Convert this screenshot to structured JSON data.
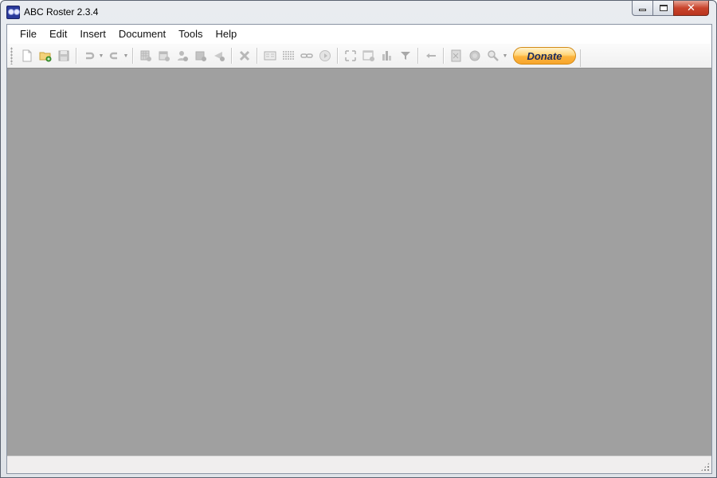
{
  "window": {
    "title": "ABC Roster 2.3.4",
    "icon": "app-logo-icon",
    "controls": [
      {
        "name": "minimize-button",
        "icon": "minimize-icon"
      },
      {
        "name": "maximize-button",
        "icon": "maximize-icon"
      },
      {
        "name": "close-button",
        "icon": "close-icon",
        "glyph": "✕"
      }
    ]
  },
  "menubar": {
    "items": [
      "File",
      "Edit",
      "Insert",
      "Document",
      "Tools",
      "Help"
    ]
  },
  "toolbar": {
    "buttons": [
      {
        "name": "new-button",
        "icon": "new-document-icon",
        "enabled": true
      },
      {
        "name": "open-button",
        "icon": "open-folder-icon",
        "enabled": true
      },
      {
        "name": "save-button",
        "icon": "save-disk-icon",
        "enabled": false
      },
      {
        "name": "undo-button",
        "icon": "undo-icon",
        "enabled": false,
        "dropdown": true
      },
      {
        "name": "redo-button",
        "icon": "redo-icon",
        "enabled": false,
        "dropdown": true
      },
      {
        "name": "add-roster-button",
        "icon": "add-grid-icon",
        "enabled": false
      },
      {
        "name": "add-calendar-button",
        "icon": "add-calendar-icon",
        "enabled": false
      },
      {
        "name": "add-person-button",
        "icon": "add-person-icon",
        "enabled": false
      },
      {
        "name": "add-shift-button",
        "icon": "add-box-icon",
        "enabled": false
      },
      {
        "name": "add-announcement-button",
        "icon": "add-megaphone-icon",
        "enabled": false
      },
      {
        "name": "delete-button",
        "icon": "delete-x-icon",
        "enabled": false
      },
      {
        "name": "properties-button",
        "icon": "properties-card-icon",
        "enabled": false
      },
      {
        "name": "columns-button",
        "icon": "columns-grid-icon",
        "enabled": false
      },
      {
        "name": "link-button",
        "icon": "link-chain-icon",
        "enabled": false
      },
      {
        "name": "play-button",
        "icon": "play-circle-icon",
        "enabled": false
      },
      {
        "name": "fit-button",
        "icon": "expand-arrows-icon",
        "enabled": false
      },
      {
        "name": "schedule-button",
        "icon": "window-clock-icon",
        "enabled": false
      },
      {
        "name": "statistics-button",
        "icon": "bar-chart-icon",
        "enabled": false
      },
      {
        "name": "filter-button",
        "icon": "filter-funnel-icon",
        "enabled": false
      },
      {
        "name": "back-button",
        "icon": "arrow-left-icon",
        "enabled": false
      },
      {
        "name": "export-button",
        "icon": "export-document-icon",
        "enabled": false
      },
      {
        "name": "refresh-button",
        "icon": "refresh-globe-icon",
        "enabled": false
      },
      {
        "name": "zoom-button",
        "icon": "magnifier-icon",
        "enabled": false,
        "dropdown": true
      }
    ],
    "donate_label": "Donate"
  },
  "statusbar": {
    "text": ""
  },
  "colors": {
    "workspace": "#a0a0a0",
    "donate_accent": "#fcb43e",
    "donate_text": "#1a2b5e",
    "close_button": "#c9442c"
  }
}
